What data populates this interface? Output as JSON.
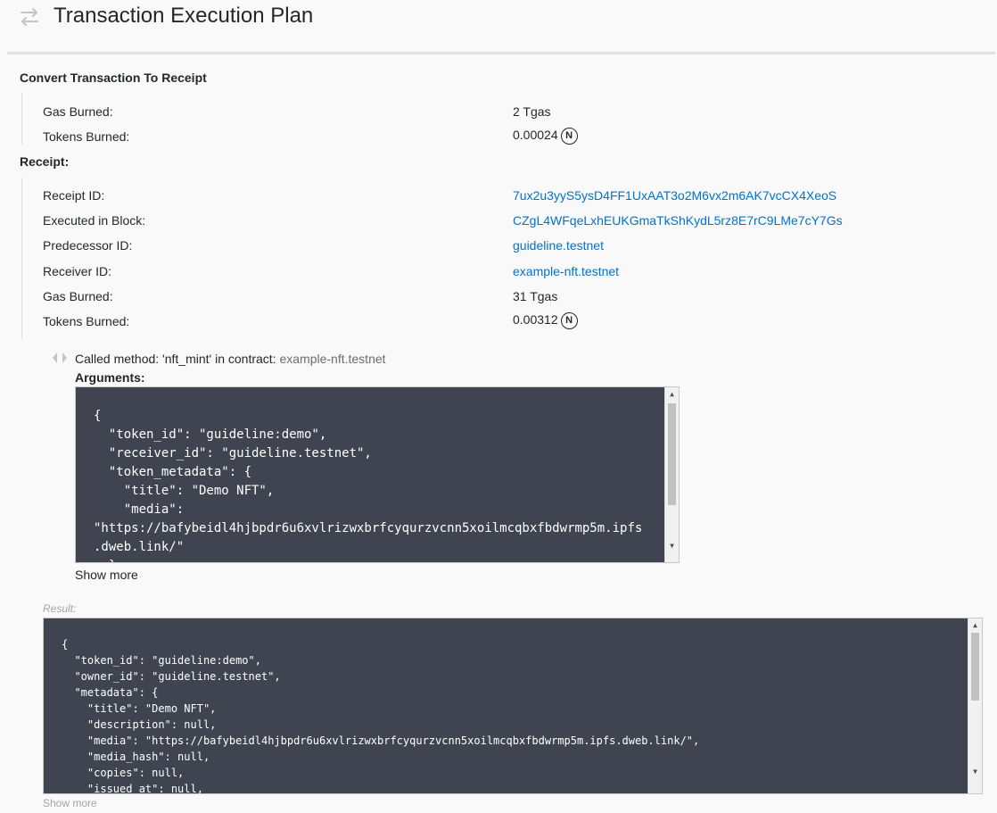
{
  "header": {
    "title": "Transaction Execution Plan"
  },
  "convert": {
    "heading": "Convert Transaction To Receipt",
    "rows": [
      {
        "label": "Gas Burned:",
        "value": "2 Tgas"
      },
      {
        "label": "Tokens Burned:",
        "value": "0.00024"
      }
    ]
  },
  "receipt": {
    "heading": "Receipt:",
    "rows": [
      {
        "label": "Receipt ID:",
        "value": "7ux2u3yyS5ysD4FF1UxAAT3o2M6vx2m6AK7vcCX4XeoS"
      },
      {
        "label": "Executed in Block:",
        "value": "CZgL4WFqeLxhEUKGmaTkShKydL5rz8E7rC9LMe7cY7Gs"
      },
      {
        "label": "Predecessor ID:",
        "value": "guideline.testnet"
      },
      {
        "label": "Receiver ID:",
        "value": "example-nft.testnet"
      },
      {
        "label": "Gas Burned:",
        "value": "31 Tgas"
      },
      {
        "label": "Tokens Burned:",
        "value": "0.00312"
      }
    ],
    "near_symbol": "N"
  },
  "action": {
    "icon": "code-icon",
    "called_prefix": "Called method: 'nft_mint' in contract: ",
    "contract": "example-nft.testnet",
    "arguments_label": "Arguments:",
    "arguments_code": "{\n  \"token_id\": \"guideline:demo\",\n  \"receiver_id\": \"guideline.testnet\",\n  \"token_metadata\": {\n    \"title\": \"Demo NFT\",\n    \"media\":\n\"https://bafybeidl4hjbpdr6u6xvlrizwxbrfcyqurzvcnn5xoilmcqbxfbdwrmp5m.ipfs\n.dweb.link/\"\n  }",
    "show_more": "Show more"
  },
  "result": {
    "label": "Result:",
    "code": "{\n  \"token_id\": \"guideline:demo\",\n  \"owner_id\": \"guideline.testnet\",\n  \"metadata\": {\n    \"title\": \"Demo NFT\",\n    \"description\": null,\n    \"media\": \"https://bafybeidl4hjbpdr6u6xvlrizwxbrfcyqurzvcnn5xoilmcqbxfbdwrmp5m.ipfs.dweb.link/\",\n    \"media_hash\": null,\n    \"copies\": null,\n    \"issued_at\": null,",
    "show_more": "Show more"
  },
  "colors": {
    "link": "#0072ce",
    "code_bg": "#3f4450",
    "muted": "#a5a5a5"
  }
}
